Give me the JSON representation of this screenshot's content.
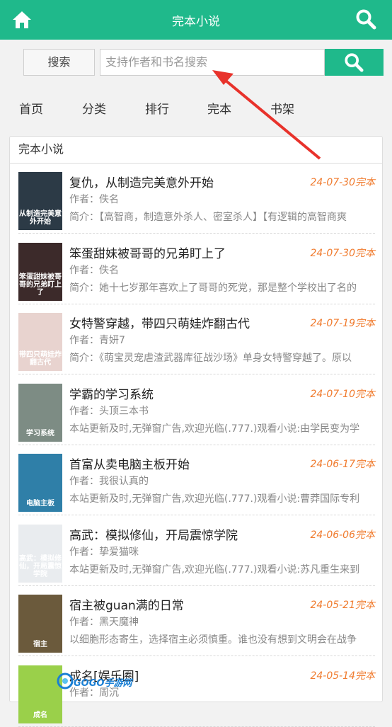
{
  "header": {
    "title": "完本小说"
  },
  "search": {
    "button_label": "搜索",
    "placeholder": "支持作者和书名搜索"
  },
  "nav": {
    "items": [
      "首页",
      "分类",
      "排行",
      "完本",
      "书架"
    ]
  },
  "panel": {
    "title": "完本小说"
  },
  "books": [
    {
      "title": "复仇，从制造完美意外开始",
      "date": "24-07-30完本",
      "author": "作者：佚名",
      "intro": "简介：【高智商，制造意外杀人、密室杀人】【有逻辑的高智商爽",
      "cover_text": "从制造完美意外开始",
      "cover_color": "#2c3a46"
    },
    {
      "title": "笨蛋甜妹被哥哥的兄弟盯上了",
      "date": "24-07-30完本",
      "author": "作者：佚名",
      "intro": "简介：她十七岁那年喜欢上了哥哥的死党，那是整个学校出了名的",
      "cover_text": "笨蛋甜妹被哥哥的兄弟盯上了",
      "cover_color": "#3c2a2a"
    },
    {
      "title": "女特警穿越，带四只萌娃炸翻古代",
      "date": "24-07-19完本",
      "author": "作者：青妍7",
      "intro": "简介：《萌宝灵宠虐渣武器库征战沙场》单身女特警穿越了。原以",
      "cover_text": "带四只萌娃炸翻古代",
      "cover_color": "#e8d3cf"
    },
    {
      "title": "学霸的学习系统",
      "date": "24-07-10完本",
      "author": "作者：头顶三本书",
      "intro": "本站更新及时,无弹窗广告,欢迎光临(.777.)观看小说:由学民变为学",
      "cover_text": "学习系统",
      "cover_color": "#7d8c84"
    },
    {
      "title": "首富从卖电脑主板开始",
      "date": "24-06-17完本",
      "author": "作者：我很认真的",
      "intro": "本站更新及时,无弹窗广告,欢迎光临(.777.)观看小说:曹莽国际专利",
      "cover_text": "电脑主板",
      "cover_color": "#2f7fa8"
    },
    {
      "title": "高武：模拟修仙，开局震惊学院",
      "date": "24-06-06完本",
      "author": "作者：挚爱猫咪",
      "intro": "本站更新及时,无弹窗广告,欢迎光临(.777.)观看小说:苏凡重生来到",
      "cover_text": "高武：模拟修仙，开局震惊学院",
      "cover_color": "#e9ecef"
    },
    {
      "title": "宿主被guan满的日常",
      "date": "24-05-21完本",
      "author": "作者：黑天魔神",
      "intro": "以细胞形态寄生，选择宿主必须慎重。谁也没有想到文明会在战争",
      "cover_text": "宿主",
      "cover_color": "#6b5a3c"
    },
    {
      "title": "成名[娱乐圈]",
      "date": "24-05-14完本",
      "author": "作者：周沉",
      "intro": "",
      "cover_text": "成名",
      "cover_color": "#9ad04a"
    }
  ],
  "watermark": {
    "text": "GOGO手游网"
  },
  "colors": {
    "accent": "#1fb98b",
    "date": "#f07b2e",
    "arrow": "#e8322b"
  }
}
